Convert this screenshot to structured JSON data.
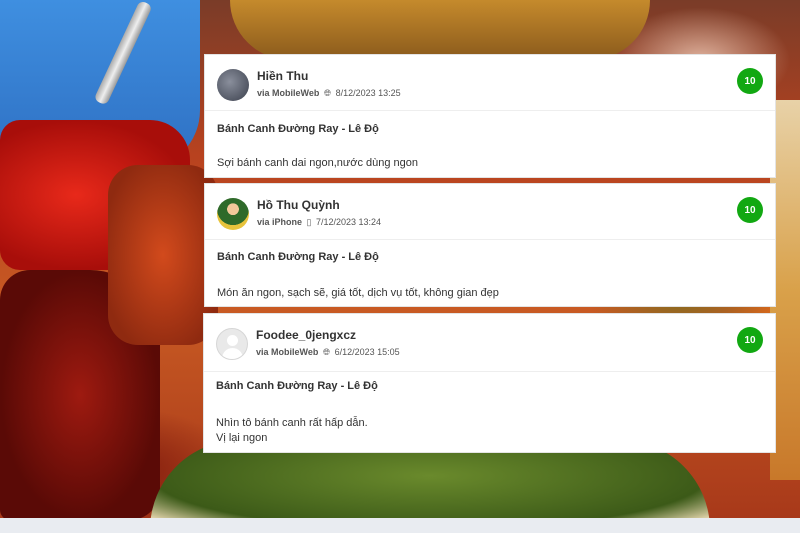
{
  "reviews": [
    {
      "user": "Hiền Thu",
      "via": "via MobileWeb",
      "device_icon": "globe-icon",
      "date": "8/12/2023 13:25",
      "score": "10",
      "place": "Bánh Canh Đường Ray - Lê Độ",
      "comment": "Sợi bánh canh dai ngon,nước dùng ngon"
    },
    {
      "user": "Hồ Thu Quỳnh",
      "via": "via iPhone",
      "device_icon": "phone-icon",
      "date": "7/12/2023 13:24",
      "score": "10",
      "place": "Bánh Canh Đường Ray - Lê Độ",
      "comment": "Món ăn ngon, sạch sẽ, giá tốt, dịch vụ tốt, không gian đẹp"
    },
    {
      "user": "Foodee_0jengxcz",
      "via": "via MobileWeb",
      "device_icon": "globe-icon",
      "date": "6/12/2023 15:05",
      "score": "10",
      "place": "Bánh Canh Đường Ray - Lê Độ",
      "comment": "Nhìn tô bánh canh rất hấp dẫn.\nVị lại ngon"
    }
  ],
  "colors": {
    "score_badge": "#12a812",
    "card_bg": "#ffffff"
  }
}
